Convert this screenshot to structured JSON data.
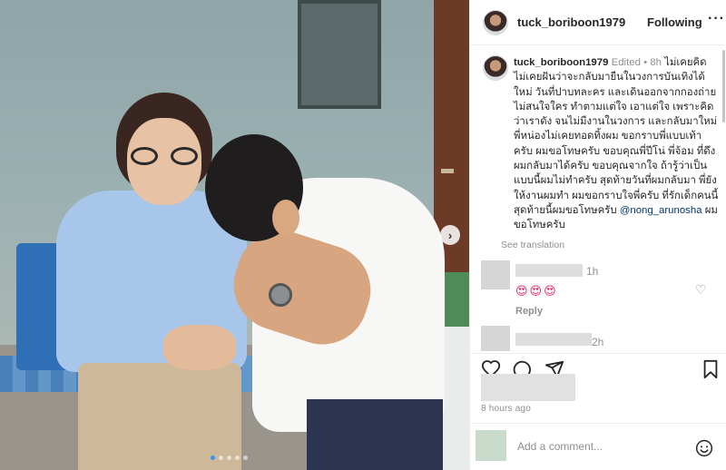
{
  "post": {
    "username": "tuck_boriboon1979",
    "follow_label": "Following",
    "more_label": "···",
    "caption_username": "tuck_boriboon1979",
    "edited_label": "Edited",
    "caption_time": "8h",
    "caption_text": "ไม่เคยคิด ไม่เคยฝันว่าจะกลับมายืนในวงการบันเทิงได้ใหม่ วันที่ปาบทละคร และเดินออกจากกองถ่าย ไม่สนใจใคร ทำตามแต่ใจ เอาแต่ใจ เพราะคิดว่าเราดัง จนไม่มีงานในวงการ และกลับมาใหม่ พี่หน่องไม่เคยทอดทิ้งผม ขอกราบพี่แบบเท้าครับ ผมขอโทษครับ ขอบคุณพี่ปีโน่ พี่จ้อม ที่ดึงผมกลับมาได้ครับ ขอบคุณจากใจ ถ้ารู้ว่าเป็นแบบนี้ผมไม่ทำครับ สุดท้ายวันที่ผมกลับมา พี่ยังให้งานผมทำ ผมขอกราบใจพี่ครับ ที่รักเด็กคนนี้ สุดท้ายนี้ผมขอโทษครับ",
    "mention": "@nong_arunosha",
    "caption_end": "ผมขอโทษครับ",
    "see_translation": "See translation",
    "post_time": "8 hours ago"
  },
  "comments": [
    {
      "time": "1h",
      "emojis": "😍😍😍",
      "reply_label": "Reply"
    },
    {
      "time": "2h"
    }
  ],
  "add_comment": {
    "placeholder": "Add a comment..."
  },
  "carousel": {
    "next_label": "›",
    "slide_count": 5,
    "active_index": 0
  },
  "icons": [
    "heart-icon",
    "comment-icon",
    "share-icon",
    "bookmark-icon",
    "emoji-icon",
    "chevron-right-icon",
    "more-icon"
  ],
  "colors": {
    "mention": "#00376b",
    "meta_text": "#8e8e8e",
    "text": "#262626",
    "carousel_dot_active": "#3897f0"
  }
}
